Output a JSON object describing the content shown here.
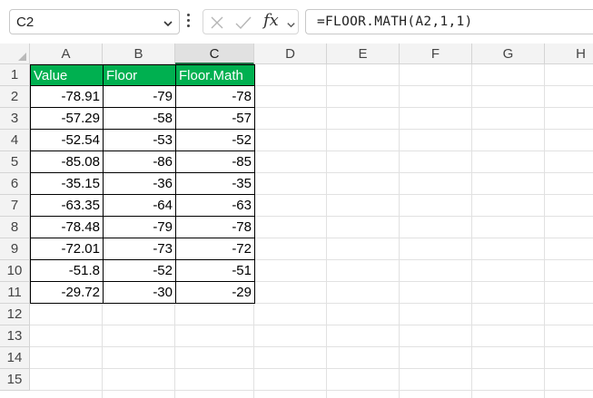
{
  "name_box": {
    "value": "C2"
  },
  "formula_bar": {
    "fx_label": "fx",
    "formula": "=FLOOR.MATH(A2,1,1)"
  },
  "columns": [
    "A",
    "B",
    "C",
    "D",
    "E",
    "F",
    "G",
    "H"
  ],
  "selected_column": "C",
  "rows": [
    "1",
    "2",
    "3",
    "4",
    "5",
    "6",
    "7",
    "8",
    "9",
    "10",
    "11",
    "12",
    "13",
    "14",
    "15"
  ],
  "table": {
    "headers": [
      "Value",
      "Floor",
      "Floor.Math"
    ],
    "header_fill": "#00b050",
    "header_text_color": "#ffffff",
    "rows": [
      [
        "-78.91",
        "-79",
        "-78"
      ],
      [
        "-57.29",
        "-58",
        "-57"
      ],
      [
        "-52.54",
        "-53",
        "-52"
      ],
      [
        "-85.08",
        "-86",
        "-85"
      ],
      [
        "-35.15",
        "-36",
        "-35"
      ],
      [
        "-63.35",
        "-64",
        "-63"
      ],
      [
        "-78.48",
        "-79",
        "-78"
      ],
      [
        "-72.01",
        "-73",
        "-72"
      ],
      [
        "-51.8",
        "-52",
        "-51"
      ],
      [
        "-29.72",
        "-30",
        "-29"
      ]
    ]
  },
  "icons": {
    "name_box_dropdown": "chevron-down-icon",
    "more_options": "kebab-icon",
    "cancel": "close-icon",
    "enter": "checkmark-icon",
    "function_dropdown": "chevron-down-icon",
    "select_all": "select-all-triangle-icon"
  }
}
